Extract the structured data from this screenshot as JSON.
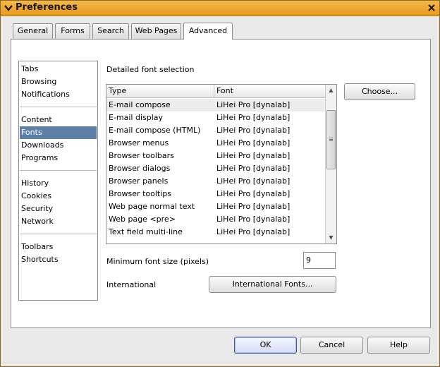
{
  "window": {
    "title": "Preferences"
  },
  "tabs": [
    "General",
    "Forms",
    "Search",
    "Web Pages",
    "Advanced"
  ],
  "active_tab": "Advanced",
  "sidebar": {
    "groups": [
      [
        "Tabs",
        "Browsing",
        "Notifications"
      ],
      [
        "Content",
        "Fonts",
        "Downloads",
        "Programs"
      ],
      [
        "History",
        "Cookies",
        "Security",
        "Network"
      ],
      [
        "Toolbars",
        "Shortcuts"
      ]
    ],
    "selected": "Fonts"
  },
  "fonts": {
    "section_title": "Detailed font selection",
    "columns": [
      "Type",
      "Font"
    ],
    "rows": [
      [
        "E-mail compose",
        "LiHei Pro [dynalab]"
      ],
      [
        "E-mail display",
        "LiHei Pro [dynalab]"
      ],
      [
        "E-mail compose (HTML)",
        "LiHei Pro [dynalab]"
      ],
      [
        "Browser menus",
        "LiHei Pro [dynalab]"
      ],
      [
        "Browser toolbars",
        "LiHei Pro [dynalab]"
      ],
      [
        "Browser dialogs",
        "LiHei Pro [dynalab]"
      ],
      [
        "Browser panels",
        "LiHei Pro [dynalab]"
      ],
      [
        "Browser tooltips",
        "LiHei Pro [dynalab]"
      ],
      [
        "Web page normal text",
        "LiHei Pro [dynalab]"
      ],
      [
        "Web page <pre>",
        "LiHei Pro [dynalab]"
      ],
      [
        "Text field multi-line",
        "LiHei Pro [dynalab]"
      ]
    ],
    "choose_label": "Choose...",
    "min_size_label": "Minimum font size (pixels)",
    "min_size_value": "9",
    "international_label": "International",
    "international_button": "International Fonts..."
  },
  "footer": {
    "ok": "OK",
    "cancel": "Cancel",
    "help": "Help"
  }
}
